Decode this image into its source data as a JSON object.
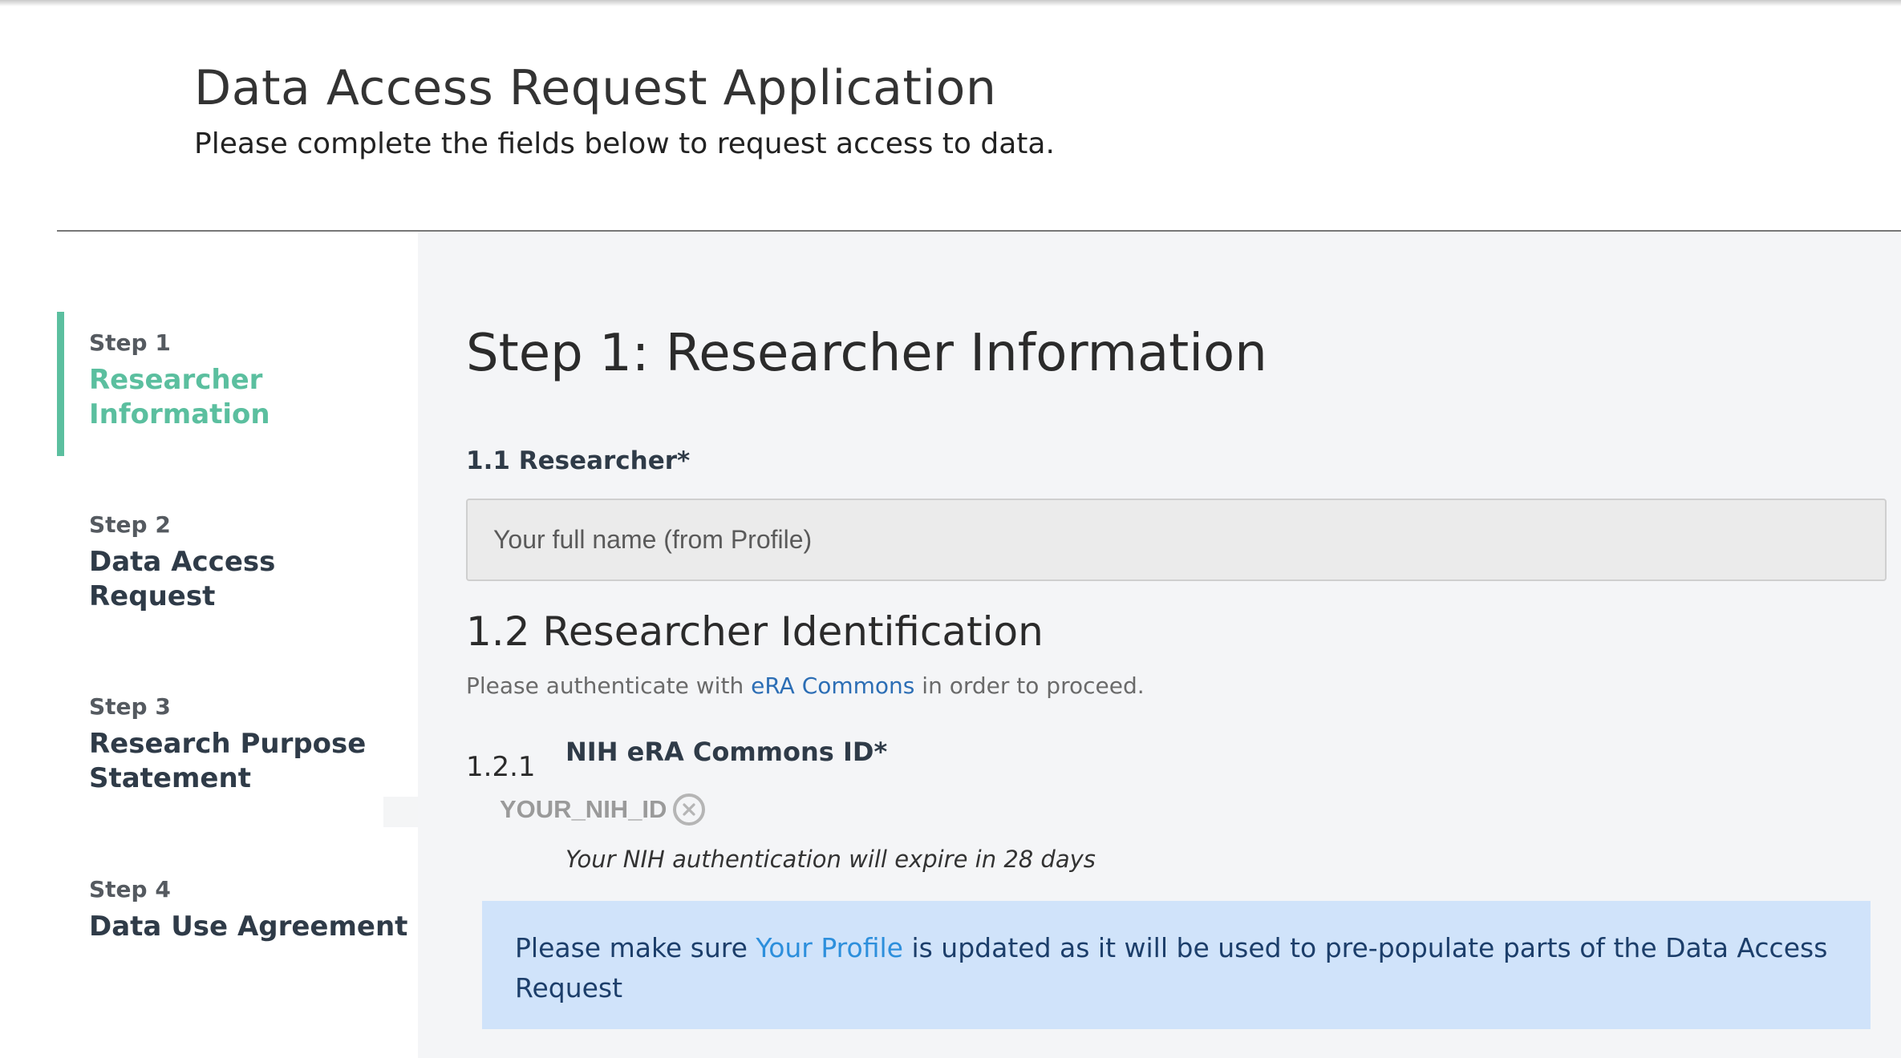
{
  "header": {
    "title": "Data Access Request Application",
    "subtitle": "Please complete the fields below to request access to data."
  },
  "sidebar": {
    "steps": [
      {
        "number": "Step 1",
        "name": "Researcher Information",
        "active": true
      },
      {
        "number": "Step 2",
        "name": "Data Access Request",
        "active": false
      },
      {
        "number": "Step 3",
        "name": "Research Purpose Statement",
        "active": false
      },
      {
        "number": "Step 4",
        "name": "Data Use Agreement",
        "active": false
      }
    ]
  },
  "main": {
    "heading": "Step 1: Researcher Information",
    "researcher": {
      "label": "1.1 Researcher*",
      "placeholder": "Your full name (from Profile)",
      "value": ""
    },
    "identification": {
      "heading": "1.2 Researcher Identification",
      "auth_prefix": "Please authenticate with ",
      "auth_link": "eRA Commons",
      "auth_suffix": " in order to proceed.",
      "sub_number": "1.2.1",
      "sub_label": "NIH eRA Commons ID*",
      "nih_id": "YOUR_NIH_ID",
      "expire_note": "Your NIH authentication will expire in 28 days"
    },
    "banner": {
      "prefix": "Please make sure ",
      "link": "Your Profile",
      "suffix": " is updated as it will be used to pre-populate parts of the Data Access Request"
    }
  },
  "colors": {
    "accent": "#5bbf9f",
    "link": "#2c6eb5",
    "banner_bg": "#d0e3fa",
    "banner_text": "#1c3e6a",
    "main_bg": "#f4f5f7"
  },
  "icons": {
    "clear_nih_id": "close-circle-icon"
  }
}
